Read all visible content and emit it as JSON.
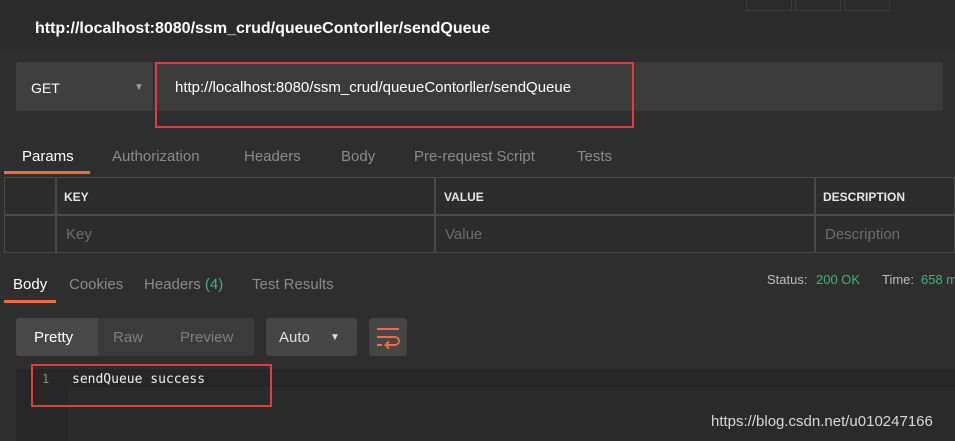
{
  "window": {
    "title": "http://localhost:8080/ssm_crud/queueContorller/sendQueue"
  },
  "request": {
    "method": "GET",
    "url": "http://localhost:8080/ssm_crud/queueContorller/sendQueue"
  },
  "request_tabs": [
    "Params",
    "Authorization",
    "Headers",
    "Body",
    "Pre-request Script",
    "Tests"
  ],
  "params_table": {
    "headers": [
      "KEY",
      "VALUE",
      "DESCRIPTION"
    ],
    "placeholders": [
      "Key",
      "Value",
      "Description"
    ]
  },
  "response_tabs": {
    "body": "Body",
    "cookies": "Cookies",
    "headers": "Headers",
    "headers_count": "(4)",
    "test_results": "Test Results"
  },
  "status": {
    "label": "Status:",
    "value": "200 OK"
  },
  "time": {
    "label": "Time:",
    "value": "658 m"
  },
  "view_modes": [
    "Pretty",
    "Raw",
    "Preview"
  ],
  "language": "Auto",
  "response_body": {
    "line_number": "1",
    "text": "sendQueue success"
  },
  "watermark": "https://blog.csdn.net/u010247166",
  "colors": {
    "accent": "#f26b3a",
    "success": "#3fb27f",
    "highlight_box": "#e23b3b"
  }
}
